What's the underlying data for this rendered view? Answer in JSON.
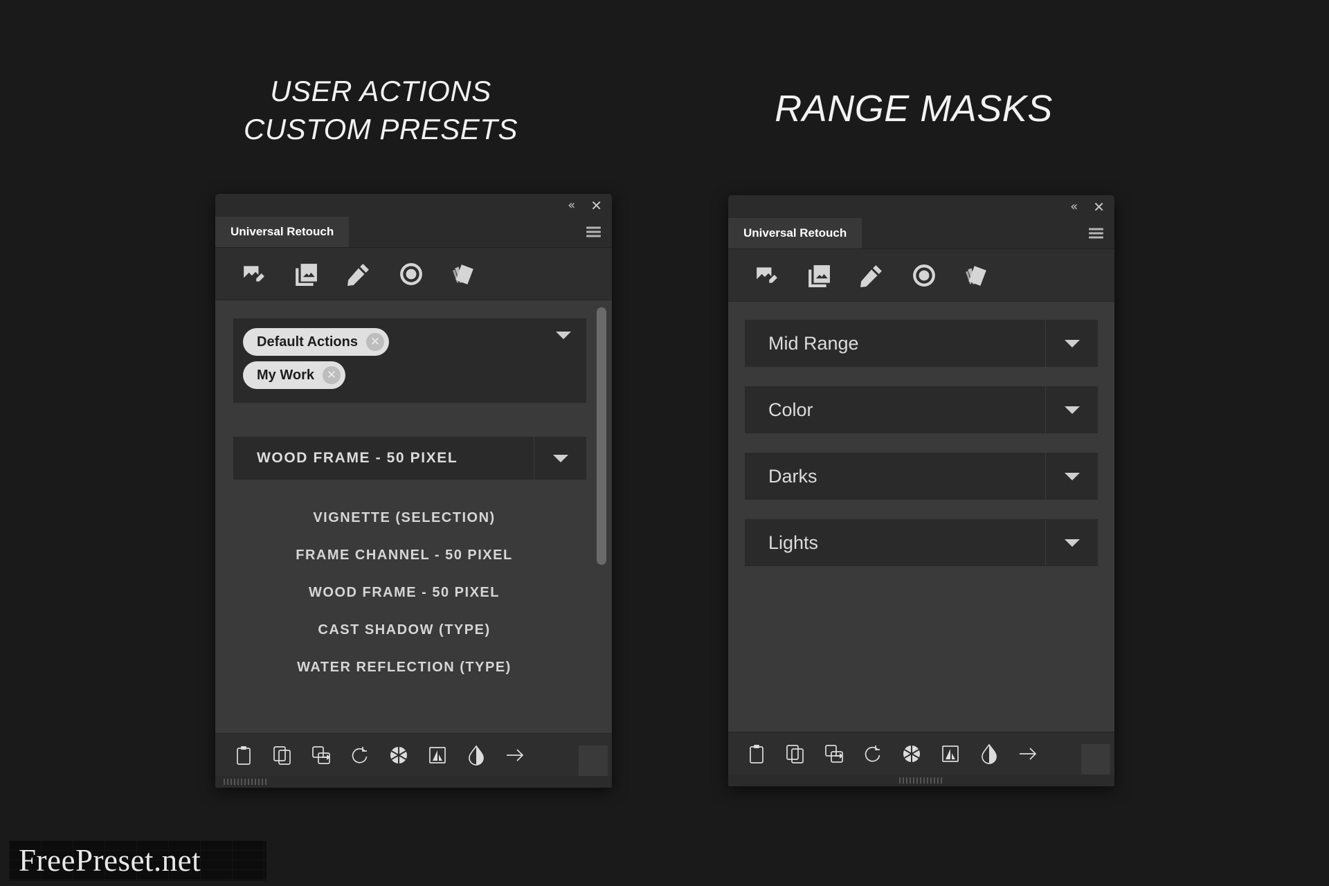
{
  "headings": {
    "left": "USER ACTIONS\nCUSTOM PRESETS",
    "right": "RANGE MASKS"
  },
  "colors": {
    "page_background": "#1a1a1a",
    "panel_background": "#323232",
    "panel_body": "#3a3a3a",
    "control_background": "#2a2a2a",
    "toolbar_background": "#2e2e2e",
    "titlebar_background": "#2b2b2b",
    "active_tab": "#383838",
    "text_primary": "#dcdcdc",
    "pill_background": "#e0e0e0",
    "pill_text": "#1d1d1d",
    "scrollbar_thumb": "#6a6a6a"
  },
  "window_controls": {
    "collapse": "«",
    "close": "✕",
    "collapse_name": "collapse-icon",
    "close_name": "close-icon",
    "menu_name": "hamburger-menu-icon"
  },
  "toolbar_icons": [
    {
      "name": "image-edit-icon",
      "label": "Image Edit"
    },
    {
      "name": "image-stack-icon",
      "label": "Image Stack"
    },
    {
      "name": "pencil-icon",
      "label": "Pencil"
    },
    {
      "name": "record-circle-icon",
      "label": "Record"
    },
    {
      "name": "color-swatches-icon",
      "label": "Swatches"
    }
  ],
  "bottom_icons": [
    {
      "name": "clipboard-icon",
      "label": "Clipboard"
    },
    {
      "name": "copy-icon",
      "label": "Copy"
    },
    {
      "name": "transfer-icon",
      "label": "Transfer"
    },
    {
      "name": "rotate-add-icon",
      "label": "Rotate Add"
    },
    {
      "name": "aperture-icon",
      "label": "Aperture"
    },
    {
      "name": "image-frame-icon",
      "label": "Image Frame"
    },
    {
      "name": "contrast-drop-icon",
      "label": "Contrast"
    },
    {
      "name": "arrow-right-icon",
      "label": "Next"
    }
  ],
  "left_panel": {
    "tab_label": "Universal Retouch",
    "tags": [
      {
        "label": "Default Actions",
        "remove": "✕"
      },
      {
        "label": "My Work",
        "remove": "✕"
      }
    ],
    "preset_selected": "WOOD FRAME - 50 PIXEL",
    "actions": [
      "VIGNETTE (SELECTION)",
      "FRAME CHANNEL - 50 PIXEL",
      "WOOD FRAME - 50 PIXEL",
      "CAST SHADOW (TYPE)",
      "WATER REFLECTION (TYPE)"
    ]
  },
  "right_panel": {
    "tab_label": "Universal Retouch",
    "ranges": [
      "Mid Range",
      "Color",
      "Darks",
      "Lights"
    ]
  },
  "watermark": "FreePreset.net"
}
